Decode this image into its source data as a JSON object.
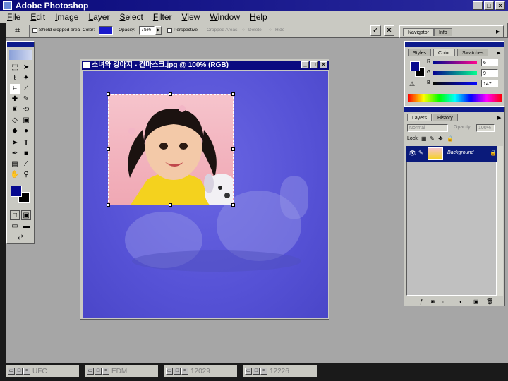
{
  "app": {
    "title": "Adobe Photoshop",
    "window_controls": [
      "_",
      "□",
      "×"
    ]
  },
  "menu": [
    "File",
    "Edit",
    "Image",
    "Layer",
    "Select",
    "Filter",
    "View",
    "Window",
    "Help"
  ],
  "options_bar": {
    "shield_label": "Shield cropped area",
    "color_label": "Color:",
    "shield_color": "#1a1acc",
    "opacity_label": "Opacity:",
    "opacity_value": "75%",
    "perspective_label": "Perspective",
    "cropped_areas_label": "Cropped Areas:",
    "delete_label": "Delete",
    "hide_label": "Hide",
    "commit_symbol": "✓",
    "cancel_symbol": "✕"
  },
  "document": {
    "title": "소녀와 강아지 - 컨마스크.jpg @ 100% (RGB)",
    "controls": [
      "_",
      "□",
      "×"
    ]
  },
  "navigator_panel": {
    "tabs": [
      "Navigator",
      "Info"
    ]
  },
  "color_panel": {
    "tabs": [
      "Styles",
      "Color",
      "Swatches"
    ],
    "channels": [
      {
        "label": "R",
        "value": "6"
      },
      {
        "label": "G",
        "value": "9"
      },
      {
        "label": "B",
        "value": "147"
      }
    ],
    "foreground": "#06098f",
    "background": "#000000"
  },
  "layers_panel": {
    "tabs": [
      "Layers",
      "History"
    ],
    "mode": "Normal",
    "opacity_label": "Opacity:",
    "opacity_value": "100%",
    "lock_label": "Lock:",
    "layer_name": "Background"
  },
  "toolbox": {
    "foreground": "#06098f",
    "background": "#000000"
  },
  "taskbar": [
    {
      "label": "UFC"
    },
    {
      "label": "EDM"
    },
    {
      "label": "12029"
    },
    {
      "label": "12226"
    }
  ]
}
